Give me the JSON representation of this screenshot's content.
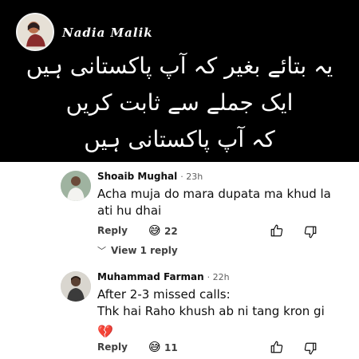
{
  "post": {
    "author": "Nadia Malik",
    "urdu_lines": [
      "یہ بتائے بغیر کہ آپ پاکستانی ہیں",
      "ایک جملے سے ثابت کریں",
      "کہ آپ پاکستانی ہیں"
    ]
  },
  "comments": [
    {
      "name": "Shoaib Mughal",
      "time": "· 23h",
      "text": "Acha muja do mara dupata ma khud la ati hu dhai",
      "reply_label": "Reply",
      "reaction_icon": "grinning-sweat-emoji",
      "reaction_count": "22",
      "view_replies": "View 1 reply"
    },
    {
      "name": "Muhammad Farman",
      "time": "· 22h",
      "text_line1": "After 2-3 missed calls:",
      "text_line2": "Thk hai Raho khush ab ni tang kron gi",
      "extra_icon": "broken-heart-emoji",
      "reply_label": "Reply",
      "reaction_icon": "grinning-sweat-emoji",
      "reaction_count": "11"
    }
  ]
}
